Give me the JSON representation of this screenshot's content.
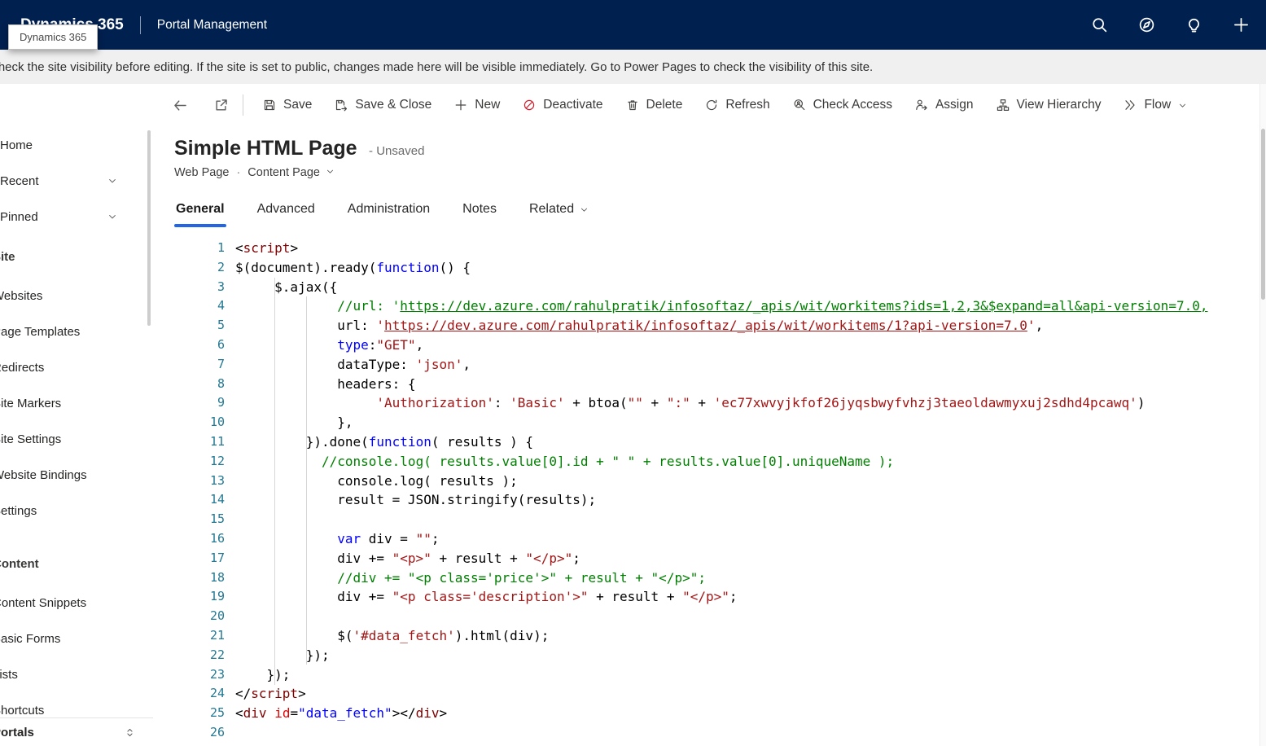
{
  "topbar": {
    "brand": "Dynamics 365",
    "tooltip": "Dynamics 365",
    "app_name": "Portal Management",
    "icons": [
      "search",
      "compass",
      "lightbulb",
      "plus"
    ]
  },
  "notification": {
    "text": "Check the site visibility before editing. If the site is set to public, changes made here will be visible immediately. Go to Power Pages to check the visibility of this site."
  },
  "sidebar": {
    "top_items": [
      {
        "label": "Home"
      },
      {
        "label": "Recent",
        "chevron": true
      },
      {
        "label": "Pinned",
        "chevron": true
      }
    ],
    "sections": [
      {
        "header": "Site",
        "items": [
          "Websites",
          "Page Templates",
          "Redirects",
          "Site Markers",
          "Site Settings",
          "Website Bindings",
          "Settings"
        ]
      },
      {
        "header": "Content",
        "items": [
          "Content Snippets",
          "Basic Forms",
          "Lists",
          "Shortcuts"
        ]
      }
    ],
    "footer": "Portals"
  },
  "command_bar": {
    "buttons": [
      {
        "label": "Save",
        "icon": "save"
      },
      {
        "label": "Save & Close",
        "icon": "save-close"
      },
      {
        "label": "New",
        "icon": "plus"
      },
      {
        "label": "Deactivate",
        "icon": "deactivate"
      },
      {
        "label": "Delete",
        "icon": "trash"
      },
      {
        "label": "Refresh",
        "icon": "refresh"
      },
      {
        "label": "Check Access",
        "icon": "check-access"
      },
      {
        "label": "Assign",
        "icon": "assign"
      },
      {
        "label": "View Hierarchy",
        "icon": "hierarchy"
      },
      {
        "label": "Flow",
        "icon": "flow",
        "chevron": true
      }
    ]
  },
  "page": {
    "title": "Simple HTML Page",
    "status": "- Unsaved",
    "entity": "Web Page",
    "separator": "·",
    "form": "Content Page",
    "tabs": [
      {
        "label": "General",
        "active": true
      },
      {
        "label": "Advanced"
      },
      {
        "label": "Administration"
      },
      {
        "label": "Notes"
      },
      {
        "label": "Related",
        "chevron": true
      }
    ]
  },
  "editor": {
    "lines": [
      [
        [
          "<",
          "d"
        ],
        [
          "script",
          "t"
        ],
        [
          ">",
          "d"
        ]
      ],
      [
        [
          "$(document).ready(",
          "d"
        ],
        [
          "function",
          "k"
        ],
        [
          "() {",
          "d"
        ]
      ],
      [
        [
          "     $.ajax({",
          "d"
        ]
      ],
      [
        [
          "             ",
          "d"
        ],
        [
          "//url: '",
          "c"
        ],
        [
          "https://dev.azure.com/rahulpratik/infosoftaz/_apis/wit/workitems?ids=1,2,3&$expand=all&api-version=7.0,",
          "cl"
        ]
      ],
      [
        [
          "             url: ",
          "d"
        ],
        [
          "'",
          "s"
        ],
        [
          "https://dev.azure.com/rahulpratik/infosoftaz/_apis/wit/workitems/1?api-version=7.0",
          "sl"
        ],
        [
          "'",
          "s"
        ],
        [
          ",",
          "d"
        ]
      ],
      [
        [
          "             ",
          "d"
        ],
        [
          "type",
          "k"
        ],
        [
          ":",
          "d"
        ],
        [
          "\"GET\"",
          "s"
        ],
        [
          ",",
          "d"
        ]
      ],
      [
        [
          "             dataType: ",
          "d"
        ],
        [
          "'json'",
          "s"
        ],
        [
          ",",
          "d"
        ]
      ],
      [
        [
          "             headers: {",
          "d"
        ]
      ],
      [
        [
          "                  ",
          "d"
        ],
        [
          "'Authorization'",
          "s"
        ],
        [
          ": ",
          "d"
        ],
        [
          "'Basic'",
          "s"
        ],
        [
          " + btoa(",
          "d"
        ],
        [
          "\"\"",
          "s"
        ],
        [
          " + ",
          "d"
        ],
        [
          "\":\"",
          "s"
        ],
        [
          " + ",
          "d"
        ],
        [
          "'ec77xwvyjkfof26jyqsbwyfvhzj3taeoldawmyxuj2sdhd4pcawq'",
          "s"
        ],
        [
          ")",
          "d"
        ]
      ],
      [
        [
          "             },",
          "d"
        ]
      ],
      [
        [
          "         }).done(",
          "d"
        ],
        [
          "function",
          "k"
        ],
        [
          "( results ) {",
          "d"
        ]
      ],
      [
        [
          "           ",
          "d"
        ],
        [
          "//console.log( results.value[0].id + \" \" + results.value[0].uniqueName );",
          "c"
        ]
      ],
      [
        [
          "             console.log( results );",
          "d"
        ]
      ],
      [
        [
          "             result = JSON.stringify(results);",
          "d"
        ]
      ],
      [],
      [
        [
          "             ",
          "d"
        ],
        [
          "var",
          "k"
        ],
        [
          " div = ",
          "d"
        ],
        [
          "\"\"",
          "s"
        ],
        [
          ";",
          "d"
        ]
      ],
      [
        [
          "             div += ",
          "d"
        ],
        [
          "\"<p>\"",
          "s"
        ],
        [
          " + result + ",
          "d"
        ],
        [
          "\"</p>\"",
          "s"
        ],
        [
          ";",
          "d"
        ]
      ],
      [
        [
          "             ",
          "d"
        ],
        [
          "//div += \"<p class='price'>\" + result + \"</p>\";",
          "c"
        ]
      ],
      [
        [
          "             div += ",
          "d"
        ],
        [
          "\"<p class='description'>\"",
          "s"
        ],
        [
          " + result + ",
          "d"
        ],
        [
          "\"</p>\"",
          "s"
        ],
        [
          ";",
          "d"
        ]
      ],
      [],
      [
        [
          "             $(",
          "d"
        ],
        [
          "'#data_fetch'",
          "s"
        ],
        [
          ").html(div);",
          "d"
        ]
      ],
      [
        [
          "         });",
          "d"
        ]
      ],
      [
        [
          "    });",
          "d"
        ]
      ],
      [
        [
          "</",
          "d"
        ],
        [
          "script",
          "t"
        ],
        [
          ">",
          "d"
        ]
      ],
      [
        [
          "<",
          "d"
        ],
        [
          "div",
          "t"
        ],
        [
          " ",
          "d"
        ],
        [
          "id",
          "a"
        ],
        [
          "=",
          "d"
        ],
        [
          "\"data_fetch\"",
          "v"
        ],
        [
          "></",
          "d"
        ],
        [
          "div",
          "t"
        ],
        [
          ">",
          "d"
        ]
      ],
      []
    ]
  },
  "colors": {
    "topbar_bg": "#002050",
    "accent": "#2266e3",
    "keyword": "#0000ff",
    "string": "#a31515",
    "comment": "#008000",
    "tag": "#800000",
    "attribute": "#e50000",
    "attribute_value": "#0000ff",
    "line_number": "#237893",
    "deactivate_red": "#cf1f2f"
  }
}
